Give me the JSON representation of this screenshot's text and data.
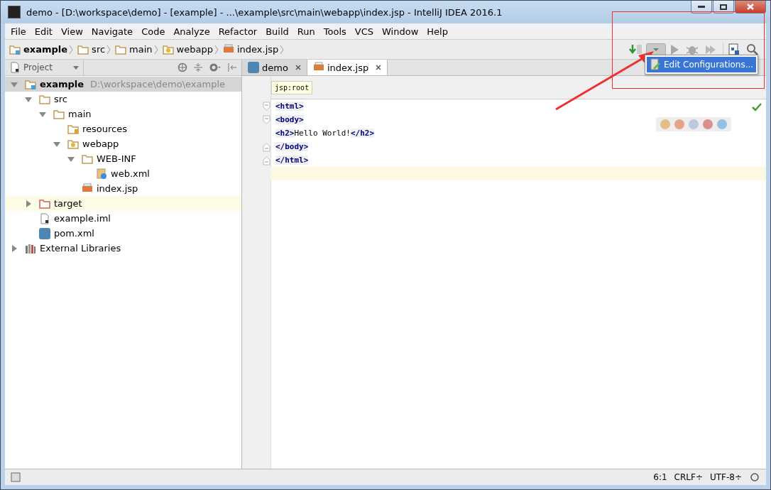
{
  "window": {
    "title": "demo - [D:\\workspace\\demo] - [example] - ...\\example\\src\\main\\webapp\\index.jsp - IntelliJ IDEA 2016.1"
  },
  "menu": [
    {
      "label": "File"
    },
    {
      "label": "Edit"
    },
    {
      "label": "View"
    },
    {
      "label": "Navigate"
    },
    {
      "label": "Code"
    },
    {
      "label": "Analyze"
    },
    {
      "label": "Refactor"
    },
    {
      "label": "Build"
    },
    {
      "label": "Run"
    },
    {
      "label": "Tools"
    },
    {
      "label": "VCS"
    },
    {
      "label": "Window"
    },
    {
      "label": "Help"
    }
  ],
  "breadcrumbs": [
    {
      "label": "example",
      "kind": "project"
    },
    {
      "label": "src",
      "kind": "folder"
    },
    {
      "label": "main",
      "kind": "folder"
    },
    {
      "label": "webapp",
      "kind": "web"
    },
    {
      "label": "index.jsp",
      "kind": "jsp"
    }
  ],
  "run_dropdown": {
    "expanded": true,
    "items": [
      {
        "label": "Edit Configurations...",
        "selected": true
      }
    ]
  },
  "project_panel": {
    "title": "Project",
    "tree": [
      {
        "label": "example",
        "path": "D:\\workspace\\demo\\example",
        "kind": "project",
        "expanded": true,
        "selected": true,
        "children": [
          {
            "label": "src",
            "kind": "folder",
            "expanded": true,
            "selected": false,
            "children": [
              {
                "label": "main",
                "kind": "folder",
                "expanded": true,
                "selected": false,
                "children": [
                  {
                    "label": "resources",
                    "kind": "resources",
                    "selected": false
                  },
                  {
                    "label": "webapp",
                    "kind": "web",
                    "expanded": true,
                    "selected": false,
                    "children": [
                      {
                        "label": "WEB-INF",
                        "kind": "folder",
                        "expanded": true,
                        "selected": false,
                        "children": [
                          {
                            "label": "web.xml",
                            "kind": "xml",
                            "selected": false
                          }
                        ]
                      },
                      {
                        "label": "index.jsp",
                        "kind": "jsp",
                        "selected": false
                      }
                    ]
                  }
                ]
              }
            ]
          },
          {
            "label": "target",
            "kind": "excluded",
            "expanded": false,
            "selected": false
          },
          {
            "label": "example.iml",
            "kind": "iml",
            "selected": false
          },
          {
            "label": "pom.xml",
            "kind": "maven",
            "selected": false
          }
        ]
      },
      {
        "label": "External Libraries",
        "kind": "libraries",
        "expanded": false,
        "selected": false
      }
    ]
  },
  "editor_tabs": [
    {
      "label": "demo",
      "kind": "maven",
      "selected": false
    },
    {
      "label": "index.jsp",
      "kind": "jsp",
      "selected": true
    }
  ],
  "editor": {
    "breadcrumb": "jsp:root",
    "lines": [
      {
        "kind": "fold-start",
        "current": false,
        "tokens": [
          {
            "kind": "tag",
            "text": "<html>"
          }
        ]
      },
      {
        "kind": "fold-start",
        "current": false,
        "tokens": [
          {
            "kind": "tag",
            "text": "<body>"
          }
        ]
      },
      {
        "kind": "plain",
        "current": false,
        "tokens": [
          {
            "kind": "tag",
            "text": "<h2>"
          },
          {
            "kind": "text",
            "text": "Hello World!"
          },
          {
            "kind": "tag",
            "text": "</h2>"
          }
        ]
      },
      {
        "kind": "fold-end",
        "current": false,
        "tokens": [
          {
            "kind": "tag",
            "text": "</body>"
          }
        ]
      },
      {
        "kind": "fold-end",
        "current": false,
        "tokens": [
          {
            "kind": "tag",
            "text": "</html>"
          }
        ]
      },
      {
        "kind": "plain",
        "current": true
      }
    ]
  },
  "status_bar": {
    "items": [
      "6:1",
      "CRLF÷",
      "UTF-8÷"
    ]
  }
}
